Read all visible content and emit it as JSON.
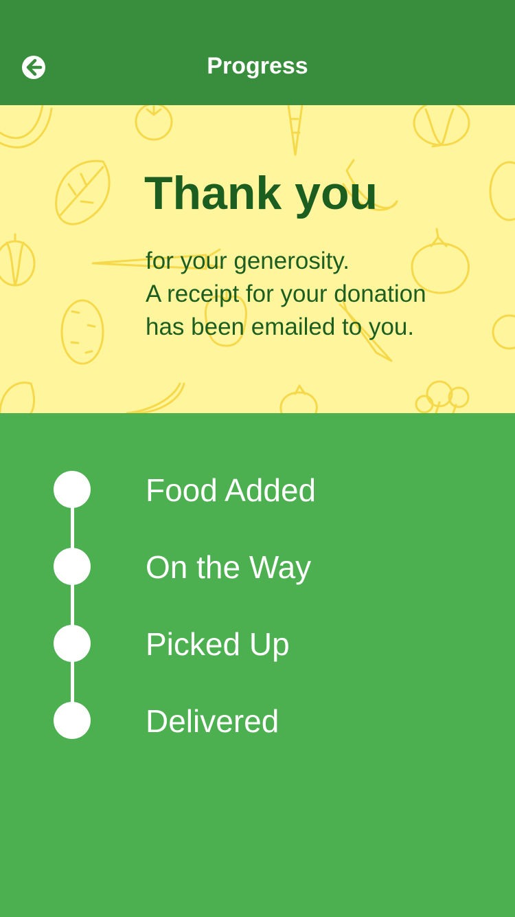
{
  "header": {
    "title": "Progress",
    "back_icon": "arrow-left-circle-icon"
  },
  "hero": {
    "title": "Thank you",
    "message_lines": [
      "for your generosity.",
      "A receipt for your donation",
      "has been emailed to you."
    ],
    "background_pattern": "vegetable-doodle-pattern"
  },
  "timeline": {
    "steps": [
      {
        "label": "Food Added"
      },
      {
        "label": "On the Way"
      },
      {
        "label": "Picked Up"
      },
      {
        "label": "Delivered"
      }
    ]
  },
  "colors": {
    "app_bar": "#388e3c",
    "background": "#4caf50",
    "hero_background": "#fff59d",
    "hero_text": "#1b5e20",
    "doodle": "#f5d94a",
    "timeline_white": "#ffffff"
  }
}
